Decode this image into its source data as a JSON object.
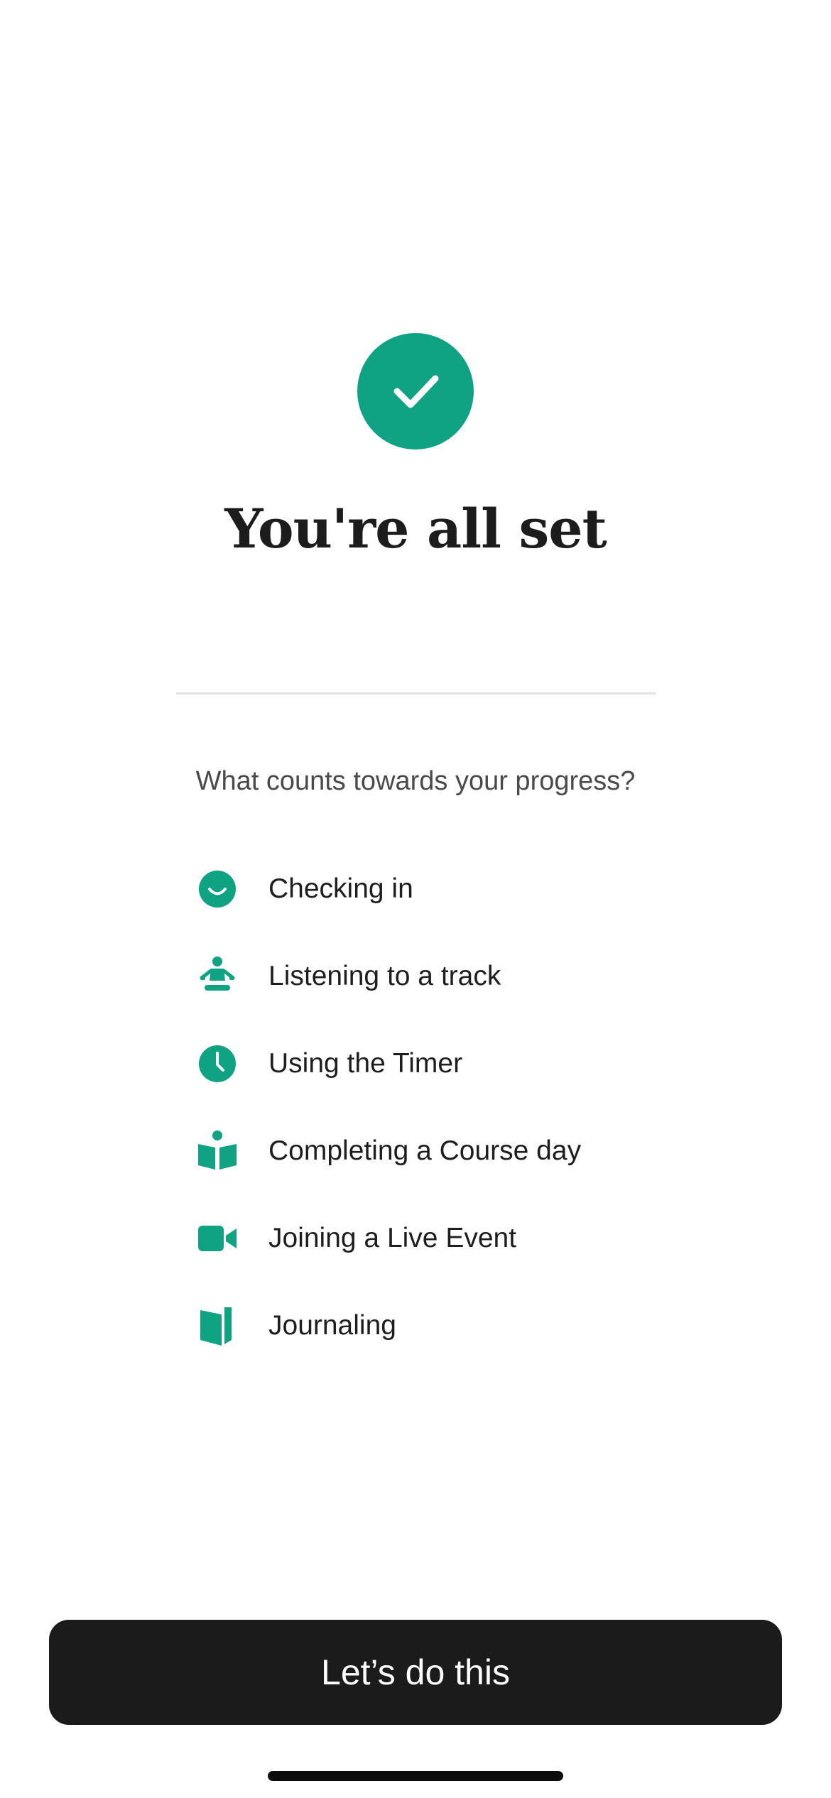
{
  "success": {
    "icon": "checkmark-icon",
    "title": "You're all set"
  },
  "progress": {
    "heading": "What counts towards your progress?",
    "items": [
      {
        "icon": "smile-face-icon",
        "label": "Checking in"
      },
      {
        "icon": "meditating-person-icon",
        "label": "Listening to a track"
      },
      {
        "icon": "clock-icon",
        "label": "Using the Timer"
      },
      {
        "icon": "open-book-icon",
        "label": "Completing a Course day"
      },
      {
        "icon": "video-camera-icon",
        "label": "Joining a Live Event"
      },
      {
        "icon": "journal-icon",
        "label": "Journaling"
      }
    ]
  },
  "cta": {
    "label": "Let’s do this"
  },
  "colors": {
    "accent": "#0fa383",
    "button": "#1b1b1b",
    "button_text": "#ffffff",
    "divider": "#e4e4e4"
  }
}
